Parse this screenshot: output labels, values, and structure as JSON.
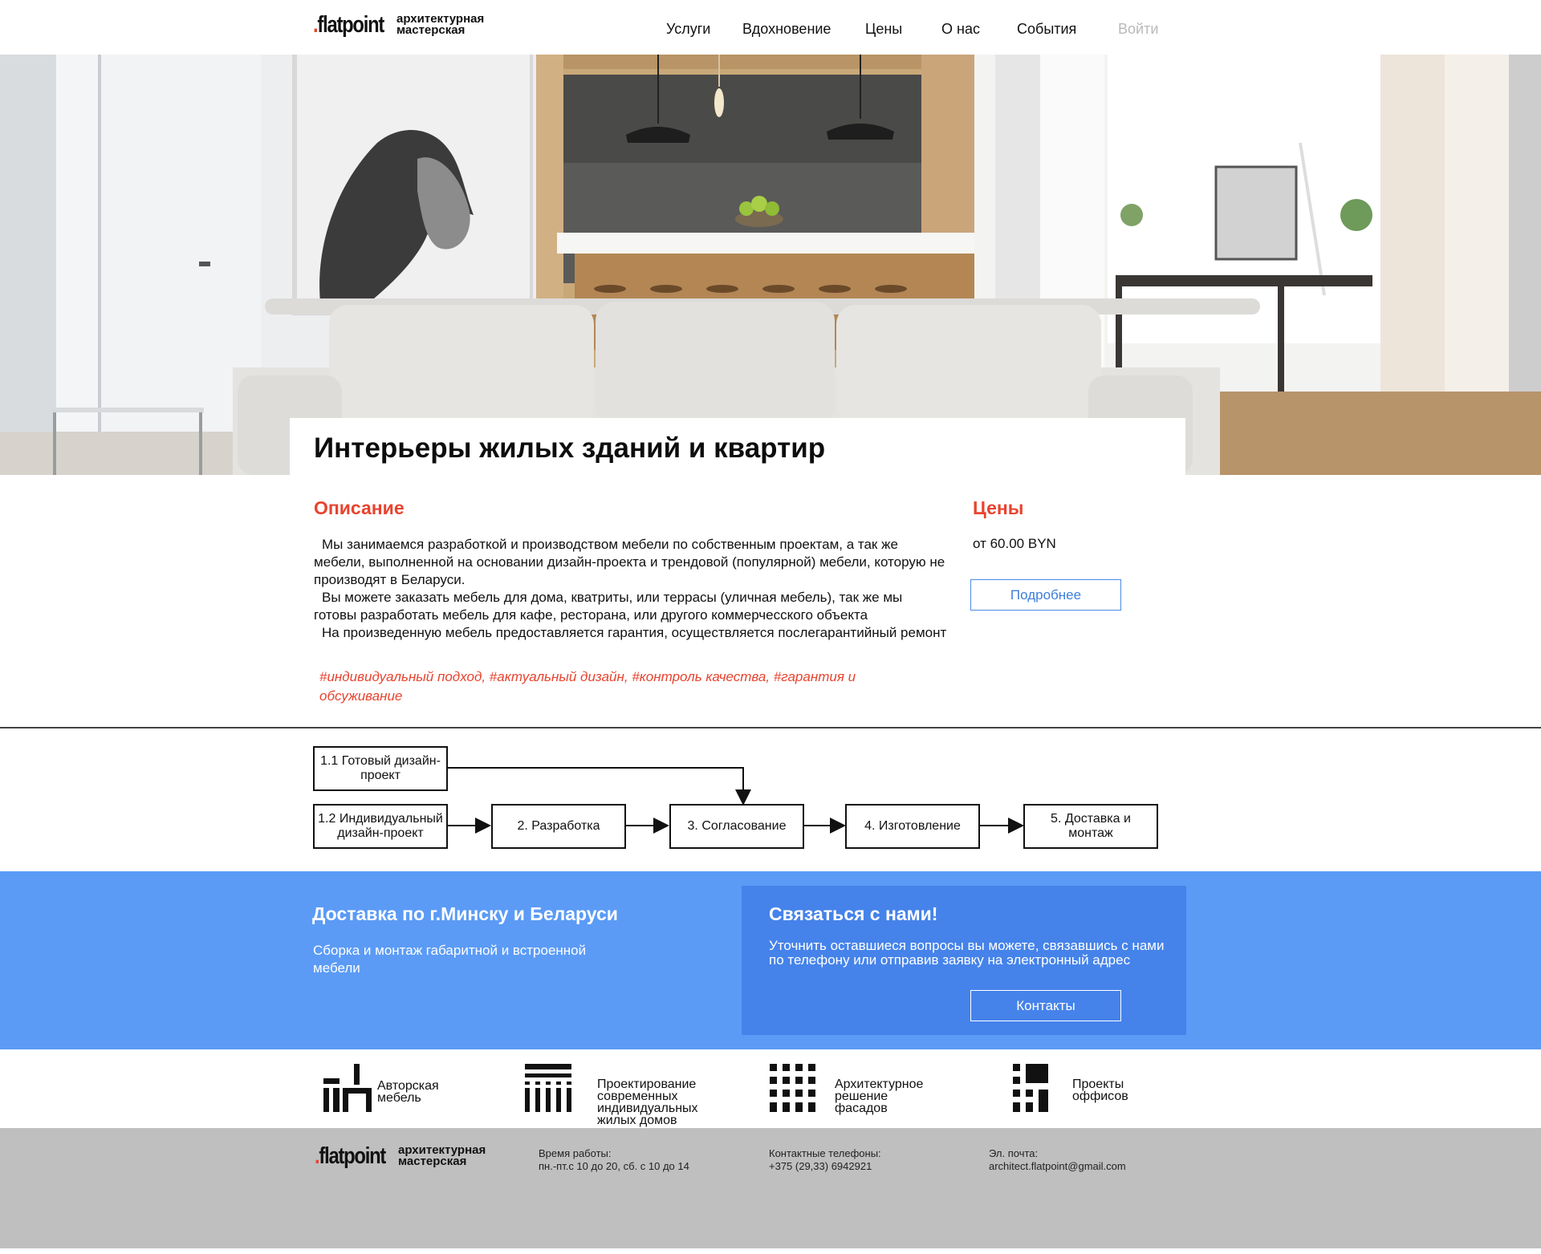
{
  "header": {
    "logo_mark": "flatpoint",
    "logo_line1": "архитектурная",
    "logo_line2": "мастерская",
    "nav": [
      "Услуги",
      "Вдохновение",
      "Цены",
      "О нас",
      "События"
    ],
    "login": "Войти"
  },
  "hero": {
    "title": "Интерьеры жилых зданий и квартир"
  },
  "description": {
    "heading": "Описание",
    "paragraphs": [
      "Мы занимаемся разработкой и производством мебели по собственным проектам, а так же мебели, выполненной на основании дизайн-проекта и трендовой (популярной) мебели, которую не производят в Беларуси.",
      "Вы можете заказать мебель для дома, кватриты, или террасы (уличная мебель), так же мы готовы разработать мебель для кафе, ресторана, или другого коммерчесского объекта",
      "На произведенную мебель предоставляется гарантия, осуществляется послегарантийный ремонт"
    ],
    "tags": "#индивидуальный подход, #актуальный дизайн, #контроль качества, #гарантия и обсуживание"
  },
  "prices": {
    "heading": "Цены",
    "value": "от 60.00 BYN",
    "more_button": "Подробнее"
  },
  "flow": {
    "steps": [
      {
        "line1": "1.1 Готовый дизайн-",
        "line2": "проект"
      },
      {
        "line1": "1.2 Индивидуальный",
        "line2": "дизайн-проект"
      },
      {
        "line1": "2. Разработка",
        "line2": ""
      },
      {
        "line1": "3. Согласование",
        "line2": ""
      },
      {
        "line1": "4. Изготовление",
        "line2": ""
      },
      {
        "line1": "5. Доставка и",
        "line2": "монтаж"
      }
    ]
  },
  "delivery": {
    "title": "Доставка по г.Минску и Беларуси",
    "text": "Сборка и монтаж габаритной и встроенной мебели"
  },
  "contact": {
    "title": "Связаться с нами!",
    "text": "Уточнить оставшиеся вопросы вы можете, связавшись с нами по телефону или отправив заявку на электронный адрес",
    "button": "Контакты"
  },
  "services": [
    {
      "icon": "furniture-icon",
      "line1": "Авторская",
      "line2": "мебель",
      "line3": "",
      "line4": ""
    },
    {
      "icon": "houses-design-icon",
      "line1": "Проектирование",
      "line2": "современных",
      "line3": "индивидуальных",
      "line4": "жилых домов"
    },
    {
      "icon": "facade-icon",
      "line1": "Архитектурное",
      "line2": "решение",
      "line3": "фасадов",
      "line4": ""
    },
    {
      "icon": "office-icon",
      "line1": "Проекты",
      "line2": "оффисов",
      "line3": "",
      "line4": ""
    }
  ],
  "footer": {
    "logo_mark": "flatpoint",
    "logo_line1": "архитектурная",
    "logo_line2": "мастерская",
    "hours_label": "Время работы:",
    "hours_value": "пн.-пт.с 10 до 20, сб. с 10 до 14",
    "phones_label": "Контактные телефоны:",
    "phones_value": "+375 (29,33) 6942921",
    "email_label": "Эл. почта:",
    "email_value": "architect.flatpoint@gmail.com"
  },
  "colors": {
    "accent_red": "#e8432e",
    "link_blue": "#3d7fdc",
    "band_blue": "#5b9bf6",
    "contact_blue": "#4583ea",
    "footer_gray": "#bfbfbf"
  }
}
